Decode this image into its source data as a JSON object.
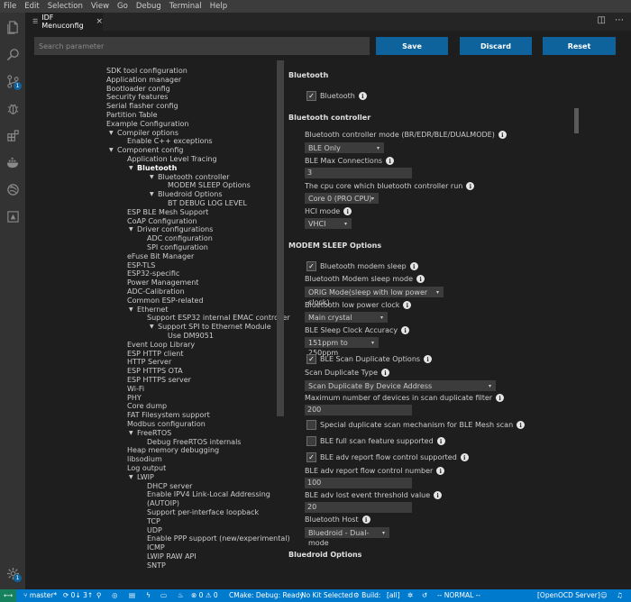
{
  "menubar": [
    "File",
    "Edit",
    "Selection",
    "View",
    "Go",
    "Debug",
    "Terminal",
    "Help"
  ],
  "activity_icons": [
    "files-icon",
    "search-icon",
    "source-control-icon",
    "debug-icon",
    "extensions-icon",
    "docker-icon",
    "remote-icon",
    "esp-idf-icon",
    "settings-gear-icon"
  ],
  "activity_badges": {
    "scm": "1",
    "settings": "1"
  },
  "tab": {
    "title": "IDF Menuconfig",
    "close": "×"
  },
  "toolbar": {
    "search_placeholder": "Search parameter",
    "save_label": "Save",
    "discard_label": "Discard",
    "reset_label": "Reset"
  },
  "tree": [
    {
      "label": "SDK tool configuration",
      "level": 0
    },
    {
      "label": "Application manager",
      "level": 0
    },
    {
      "label": "Bootloader config",
      "level": 0
    },
    {
      "label": "Security features",
      "level": 0
    },
    {
      "label": "Serial flasher config",
      "level": 0
    },
    {
      "label": "Partition Table",
      "level": 0
    },
    {
      "label": "Example Configuration",
      "level": 0
    },
    {
      "label": "Compiler options",
      "level": 1,
      "expanded": true
    },
    {
      "label": "Enable C++ exceptions",
      "level": 2
    },
    {
      "label": "Component config",
      "level": 1,
      "expanded": true
    },
    {
      "label": "Application Level Tracing",
      "level": 2
    },
    {
      "label": "Bluetooth",
      "level": 3,
      "expanded": true,
      "bold": true
    },
    {
      "label": "Bluetooth controller",
      "level": 5,
      "expanded": true
    },
    {
      "label": "MODEM SLEEP Options",
      "level": 6
    },
    {
      "label": "Bluedroid Options",
      "level": 5,
      "expanded": true
    },
    {
      "label": "BT DEBUG LOG LEVEL",
      "level": 6
    },
    {
      "label": "ESP BLE Mesh Support",
      "level": 2
    },
    {
      "label": "CoAP Configuration",
      "level": 2
    },
    {
      "label": "Driver configurations",
      "level": 3,
      "expanded": true
    },
    {
      "label": "ADC configuration",
      "level": 4
    },
    {
      "label": "SPI configuration",
      "level": 4
    },
    {
      "label": "eFuse Bit Manager",
      "level": 2
    },
    {
      "label": "ESP-TLS",
      "level": 2
    },
    {
      "label": "ESP32-specific",
      "level": 2
    },
    {
      "label": "Power Management",
      "level": 2
    },
    {
      "label": "ADC-Calibration",
      "level": 2
    },
    {
      "label": "Common ESP-related",
      "level": 2
    },
    {
      "label": "Ethernet",
      "level": 3,
      "expanded": true
    },
    {
      "label": "Support ESP32 internal EMAC controller",
      "level": 4
    },
    {
      "label": "Support SPI to Ethernet Module",
      "level": 5,
      "expanded": true
    },
    {
      "label": "Use DM9051",
      "level": 6
    },
    {
      "label": "Event Loop Library",
      "level": 2
    },
    {
      "label": "ESP HTTP client",
      "level": 2
    },
    {
      "label": "HTTP Server",
      "level": 2
    },
    {
      "label": "ESP HTTPS OTA",
      "level": 2
    },
    {
      "label": "ESP HTTPS server",
      "level": 2
    },
    {
      "label": "Wi-Fi",
      "level": 2
    },
    {
      "label": "PHY",
      "level": 2
    },
    {
      "label": "Core dump",
      "level": 2
    },
    {
      "label": "FAT Filesystem support",
      "level": 2
    },
    {
      "label": "Modbus configuration",
      "level": 2
    },
    {
      "label": "FreeRTOS",
      "level": 3,
      "expanded": true
    },
    {
      "label": "Debug FreeRTOS internals",
      "level": 4
    },
    {
      "label": "Heap memory debugging",
      "level": 2
    },
    {
      "label": "libsodium",
      "level": 2
    },
    {
      "label": "Log output",
      "level": 2
    },
    {
      "label": "LWIP",
      "level": 3,
      "expanded": true
    },
    {
      "label": "DHCP server",
      "level": 4
    },
    {
      "label": "Enable IPV4 Link-Local Addressing",
      "level": 4
    },
    {
      "label": "(AUTOIP)",
      "level": 4
    },
    {
      "label": "Support per-interface loopback",
      "level": 4
    },
    {
      "label": "TCP",
      "level": 4
    },
    {
      "label": "UDP",
      "level": 4
    },
    {
      "label": "Enable PPP support (new/experimental)",
      "level": 4
    },
    {
      "label": "ICMP",
      "level": 4
    },
    {
      "label": "LWIP RAW API",
      "level": 4
    },
    {
      "label": "SNTP",
      "level": 4
    }
  ],
  "detail": {
    "section_bluetooth": "Bluetooth",
    "bluetooth_checkbox": {
      "label": "Bluetooth",
      "checked": true
    },
    "section_controller": "Bluetooth controller",
    "controller_mode": {
      "label": "Bluetooth controller mode (BR/EDR/BLE/DUALMODE)",
      "value": "BLE Only"
    },
    "max_conn": {
      "label": "BLE Max Connections",
      "value": "3"
    },
    "cpu_core": {
      "label": "The cpu core which bluetooth controller run",
      "value": "Core 0 (PRO CPU)"
    },
    "hci_mode": {
      "label": "HCI mode",
      "value": "VHCI"
    },
    "section_modem": "MODEM SLEEP Options",
    "modem_sleep": {
      "label": "Bluetooth modem sleep",
      "checked": true
    },
    "modem_sleep_mode": {
      "label": "Bluetooth Modem sleep mode",
      "value": "ORIG Mode(sleep with low power clock)"
    },
    "low_power_clock": {
      "label": "Bluetooth low power clock",
      "value": "Main crystal"
    },
    "sleep_clock_acc": {
      "label": "BLE Sleep Clock Accuracy",
      "value": "151ppm to 250ppm"
    },
    "scan_dup": {
      "label": "BLE Scan Duplicate Options",
      "checked": true
    },
    "scan_dup_type": {
      "label": "Scan Duplicate Type",
      "value": "Scan Duplicate By Device Address"
    },
    "max_devices": {
      "label": "Maximum number of devices in scan duplicate filter",
      "value": "200"
    },
    "special_dup": {
      "label": "Special duplicate scan mechanism for BLE Mesh scan",
      "checked": false
    },
    "full_scan": {
      "label": "BLE full scan feature supported",
      "checked": false
    },
    "adv_flow": {
      "label": "BLE adv report flow control supported",
      "checked": true
    },
    "adv_flow_num": {
      "label": "BLE adv report flow control number",
      "value": "100"
    },
    "adv_lost": {
      "label": "BLE adv lost event threshold value",
      "value": "20"
    },
    "bt_host": {
      "label": "Bluetooth Host",
      "value": "Bluedroid - Dual-mode"
    },
    "section_bluedroid": "Bluedroid Options",
    "check_mark": "✓",
    "info_glyph": "i",
    "caret": "▾"
  },
  "status": {
    "remote": "⟷",
    "branch": "master*",
    "sync": "0↓ 3↑",
    "problems": "⊗ 0 ⚠ 0",
    "cmake": "CMake: Debug: Ready",
    "kit": "No Kit Selected",
    "build": "Build:",
    "build_target": "[all]",
    "mode": "-- NORMAL --",
    "openocd": "[OpenOCD Server]"
  },
  "colors": {
    "accent": "#007acc",
    "button": "#0e639c",
    "background": "#1e1e1e"
  }
}
